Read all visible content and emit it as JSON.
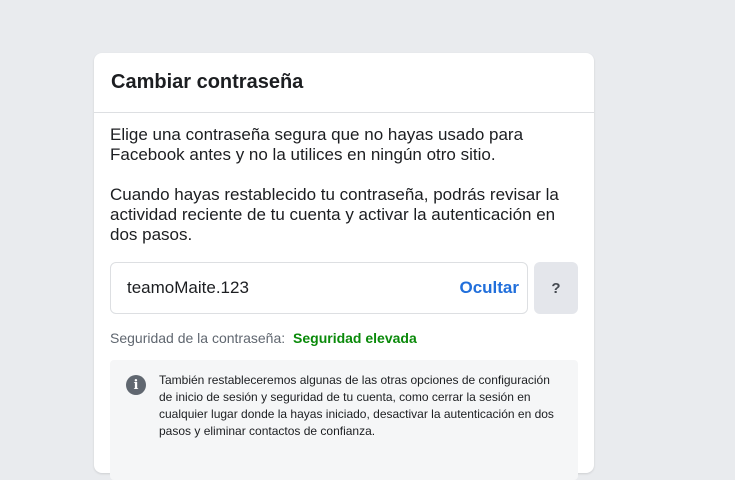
{
  "dialog": {
    "title": "Cambiar contraseña",
    "paragraph1": "Elige una contraseña segura que no hayas usado para Facebook antes y no la utilices en ningún otro sitio.",
    "paragraph2": "Cuando hayas restablecido tu contraseña, podrás revisar la actividad reciente de tu cuenta y activar la autenticación en dos pasos.",
    "password": {
      "value": "teamoMaite.123",
      "toggle_label": "Ocultar",
      "help_label": "?"
    },
    "strength": {
      "label": "Seguridad de la contraseña:",
      "value": "Seguridad elevada",
      "color": "#0a8a0a"
    },
    "info": {
      "icon": "info-icon",
      "icon_glyph": "i",
      "text": "También restableceremos algunas de las otras opciones de configuración de inicio de sesión y seguridad de tu cuenta, como cerrar la sesión en cualquier lugar donde la hayas iniciado, desactivar la autenticación en dos pasos y eliminar contactos de confianza."
    }
  }
}
